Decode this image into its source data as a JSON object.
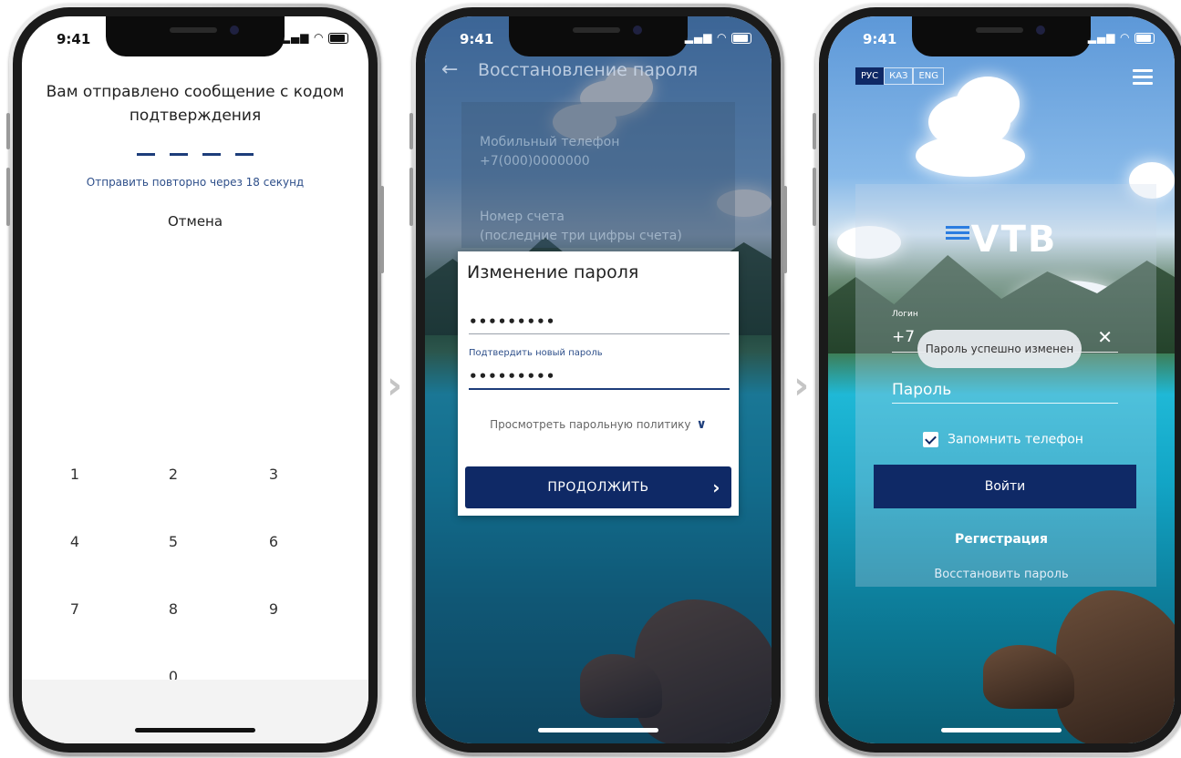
{
  "status_time": "9:41",
  "colors": {
    "brand_blue": "#0f2966",
    "link_blue": "#2e4f8a"
  },
  "phone1": {
    "title_line1": "Вам отправлено сообщение с кодом",
    "title_line2": "подтверждения",
    "resend": "Отправить повторно через 18 секунд",
    "cancel": "Отмена",
    "keys": [
      "1",
      "2",
      "3",
      "4",
      "5",
      "6",
      "7",
      "8",
      "9",
      "0"
    ]
  },
  "phone2": {
    "header_title": "Восстановление пароля",
    "bg_fields": {
      "phone_label": "Мобильный телефон",
      "phone_value": "+7(000)0000000",
      "account_label": "Номер счета",
      "account_hint": "(последние три цифры счета)"
    },
    "modal": {
      "title": "Изменение пароля",
      "new_password_value": "•••••••••",
      "confirm_label": "Подтвердить новый пароль",
      "confirm_value": "•••••••••",
      "policy_link": "Просмотреть парольную политику",
      "continue_button": "ПРОДОЛЖИТЬ"
    }
  },
  "phone3": {
    "languages": [
      "РУС",
      "КАЗ",
      "ENG"
    ],
    "logo_text": "VTB",
    "login_label": "Логин",
    "login_value": "+7",
    "toast": "Пароль успешно изменен",
    "password_placeholder": "Пароль",
    "remember_label": "Запомнить телефон",
    "login_button": "Войти",
    "register_link": "Регистрация",
    "recover_link": "Восстановить пароль"
  }
}
